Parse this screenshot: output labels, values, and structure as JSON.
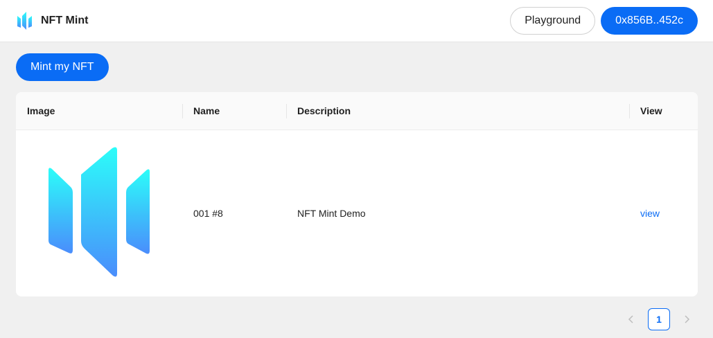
{
  "header": {
    "title": "NFT Mint",
    "logo_icon": "nft-mint-logo-icon",
    "playground_label": "Playground",
    "wallet_label": "0x856B..452c"
  },
  "actions": {
    "mint_label": "Mint my NFT"
  },
  "table": {
    "columns": [
      "Image",
      "Name",
      "Description",
      "View"
    ],
    "rows": [
      {
        "image_icon": "nft-logo-image",
        "name": "001 #8",
        "description": "NFT Mint Demo",
        "view": "view"
      }
    ]
  },
  "pagination": {
    "current_page": "1",
    "prev_icon": "chevron-left-icon",
    "next_icon": "chevron-right-icon"
  },
  "colors": {
    "primary": "#0a6cf5",
    "gradient_top": "#2cfdf9",
    "gradient_bottom": "#4a8dfc",
    "background": "#f0f0f0"
  }
}
